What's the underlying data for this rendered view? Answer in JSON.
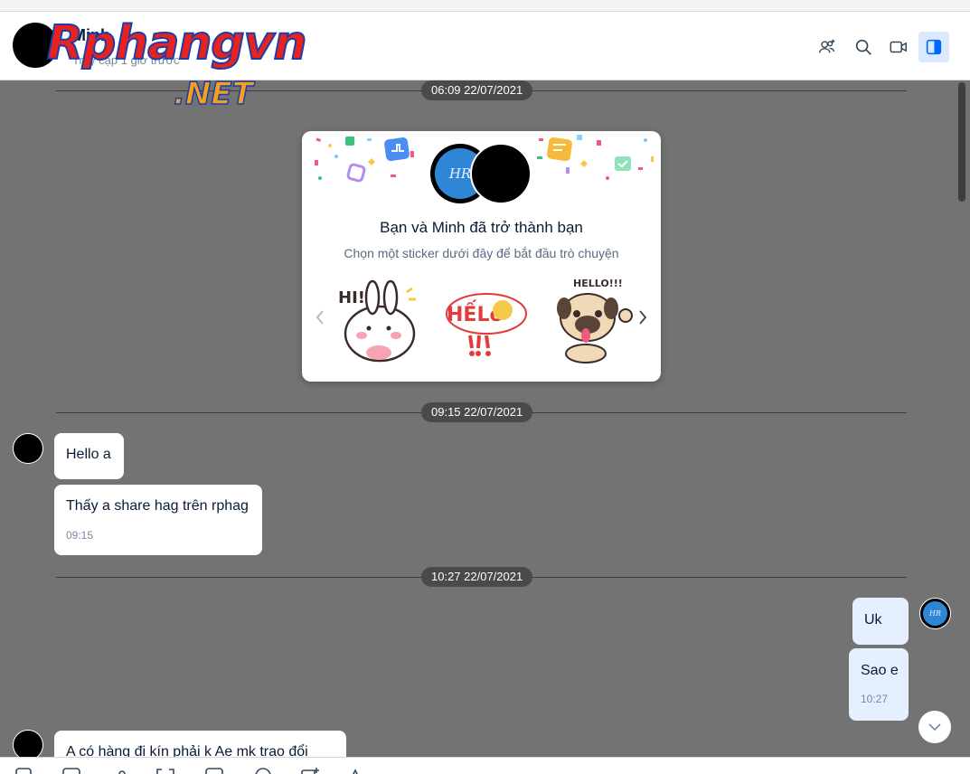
{
  "header": {
    "contact_name": "Minh",
    "status": "Truy cập 1 giờ trước",
    "icons": [
      "add-member-icon",
      "search-icon",
      "video-call-icon",
      "sidebar-toggle-icon"
    ]
  },
  "watermark": {
    "line1": "Rphangvn",
    "line2": ".NET"
  },
  "timestamps": [
    "06:09 22/07/2021",
    "09:15 22/07/2021",
    "10:27 22/07/2021"
  ],
  "friend_card": {
    "title": "Bạn và Minh đã trở thành bạn",
    "subtitle": "Chọn một sticker dưới đây để bắt đầu trò chuyện",
    "avatar_initials": "HR",
    "stickers": [
      {
        "name": "bunny-hi-sticker",
        "text": "HI!"
      },
      {
        "name": "hello-sticker",
        "text": "HẾLô"
      },
      {
        "name": "pug-hello-sticker",
        "text": "HELLO!!!"
      }
    ]
  },
  "messages": {
    "m1": {
      "text": "Hello a"
    },
    "m2": {
      "text": "Thấy a share hag trên rphag",
      "time": "09:15"
    },
    "m3": {
      "text": "Uk"
    },
    "m4": {
      "text": "Sao e",
      "time": "10:27"
    },
    "m5": {
      "text": "A có hàng  đi kín phải k   Ae mk trao đổi"
    }
  },
  "my_avatar_initials": "HR",
  "colors": {
    "accent": "#0068ff",
    "chat_bg": "#737373",
    "my_bubble": "#e5efff"
  }
}
